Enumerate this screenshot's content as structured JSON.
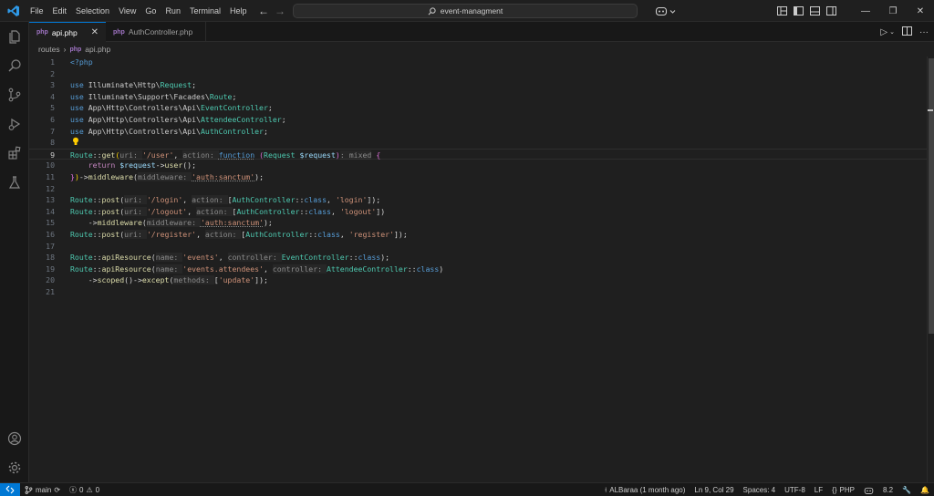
{
  "menu": [
    "File",
    "Edit",
    "Selection",
    "View",
    "Go",
    "Run",
    "Terminal",
    "Help"
  ],
  "command_center": "event-managment",
  "tabs": [
    {
      "label": "api.php",
      "active": true
    },
    {
      "label": "AuthController.php",
      "active": false
    }
  ],
  "breadcrumb": {
    "folder": "routes",
    "file": "api.php"
  },
  "editor": {
    "lines": [
      {
        "n": "1"
      },
      {
        "n": "2"
      },
      {
        "n": "3"
      },
      {
        "n": "4"
      },
      {
        "n": "5"
      },
      {
        "n": "6"
      },
      {
        "n": "7"
      },
      {
        "n": "8"
      },
      {
        "n": "9"
      },
      {
        "n": "10"
      },
      {
        "n": "11"
      },
      {
        "n": "12"
      },
      {
        "n": "13"
      },
      {
        "n": "14"
      },
      {
        "n": "15"
      },
      {
        "n": "16"
      },
      {
        "n": "17"
      },
      {
        "n": "18"
      },
      {
        "n": "19"
      },
      {
        "n": "20"
      },
      {
        "n": "21"
      }
    ],
    "code": {
      "l1": "<?php",
      "l3": [
        "use",
        "Illuminate\\Http\\",
        "Request",
        ";"
      ],
      "l4": [
        "use",
        "Illuminate\\Support\\Facades\\",
        "Route",
        ";"
      ],
      "l5": [
        "use",
        "App\\Http\\Controllers\\Api\\",
        "EventController",
        ";"
      ],
      "l6": [
        "use",
        "App\\Http\\Controllers\\Api\\",
        "AttendeeController",
        ";"
      ],
      "l7": [
        "use",
        "App\\Http\\Controllers\\Api\\",
        "AuthController",
        ";"
      ]
    }
  },
  "status": {
    "branch": "main",
    "errors": "0",
    "warnings": "0",
    "blame": "ALBaraa (1 month ago)",
    "position": "Ln 9, Col 29",
    "spaces": "Spaces: 4",
    "encoding": "UTF-8",
    "eol": "LF",
    "language": "PHP",
    "version": "8.2"
  }
}
